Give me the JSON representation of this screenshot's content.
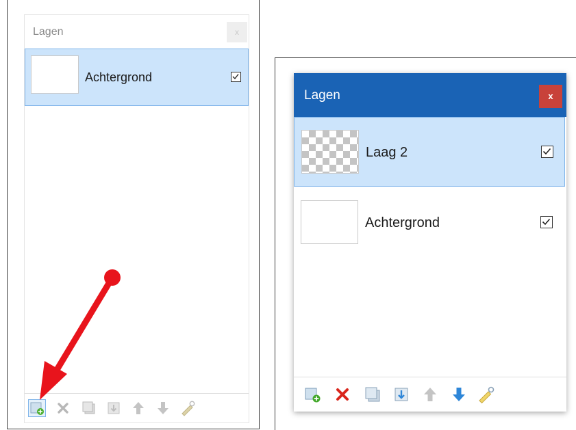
{
  "left_panel": {
    "title": "Lagen",
    "close_label": "x",
    "layers": [
      {
        "name": "Achtergrond",
        "visible": true,
        "selected": true
      }
    ],
    "toolbar_icons": [
      "add-layer-icon",
      "delete-layer-icon",
      "duplicate-layer-icon",
      "merge-layer-down-icon",
      "move-layer-up-icon",
      "move-layer-down-icon",
      "layer-properties-icon"
    ],
    "highlighted_tool": "add-layer-icon"
  },
  "right_panel": {
    "title": "Lagen",
    "close_label": "x",
    "layers": [
      {
        "name": "Laag 2",
        "visible": true,
        "selected": true,
        "transparent": true
      },
      {
        "name": "Achtergrond",
        "visible": true,
        "selected": false,
        "transparent": false
      }
    ],
    "toolbar_icons": [
      "add-layer-icon",
      "delete-layer-icon",
      "duplicate-layer-icon",
      "merge-layer-down-icon",
      "move-layer-up-icon",
      "move-layer-down-icon",
      "layer-properties-icon"
    ]
  },
  "colors": {
    "title_bar_active": "#1a63b5",
    "close_active": "#c8423a",
    "selection": "#cce4fb",
    "selection_border": "#7fb4ea",
    "annotation_arrow": "#e8141c"
  }
}
